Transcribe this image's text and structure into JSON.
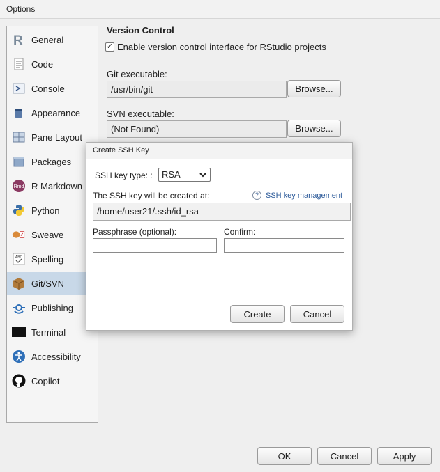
{
  "window": {
    "title": "Options"
  },
  "sidebar": {
    "items": [
      {
        "label": "General"
      },
      {
        "label": "Code"
      },
      {
        "label": "Console"
      },
      {
        "label": "Appearance"
      },
      {
        "label": "Pane Layout"
      },
      {
        "label": "Packages"
      },
      {
        "label": "R Markdown",
        "icon_text": "Rmd"
      },
      {
        "label": "Python"
      },
      {
        "label": "Sweave"
      },
      {
        "label": "Spelling",
        "icon_text": "ABC"
      },
      {
        "label": "Git/SVN"
      },
      {
        "label": "Publishing"
      },
      {
        "label": "Terminal"
      },
      {
        "label": "Accessibility"
      },
      {
        "label": "Copilot"
      }
    ],
    "selected": "Git/SVN"
  },
  "main": {
    "title": "Version Control",
    "enable_vcs_label": "Enable version control interface for RStudio projects",
    "enable_vcs_checked": true,
    "git_label": "Git executable:",
    "git_path": "/usr/bin/git",
    "svn_label": "SVN executable:",
    "svn_path": "(Not Found)",
    "browse_label": "Browse..."
  },
  "dialog": {
    "title": "Create SSH Key",
    "key_type_label": "SSH key type: :",
    "key_type_value": "RSA",
    "location_label": "The SSH key will be created at:",
    "help_link": "SSH key management",
    "location_value": "/home/user21/.ssh/id_rsa",
    "passphrase_label": "Passphrase (optional):",
    "passphrase_value": "",
    "confirm_label": "Confirm:",
    "confirm_value": "",
    "create_button": "Create",
    "cancel_button": "Cancel"
  },
  "footer": {
    "ok": "OK",
    "cancel": "Cancel",
    "apply": "Apply"
  },
  "colors": {
    "selected_bg": "#c8d8e8",
    "link": "#2d5b9a",
    "dialog_bg": "#ffffff"
  }
}
